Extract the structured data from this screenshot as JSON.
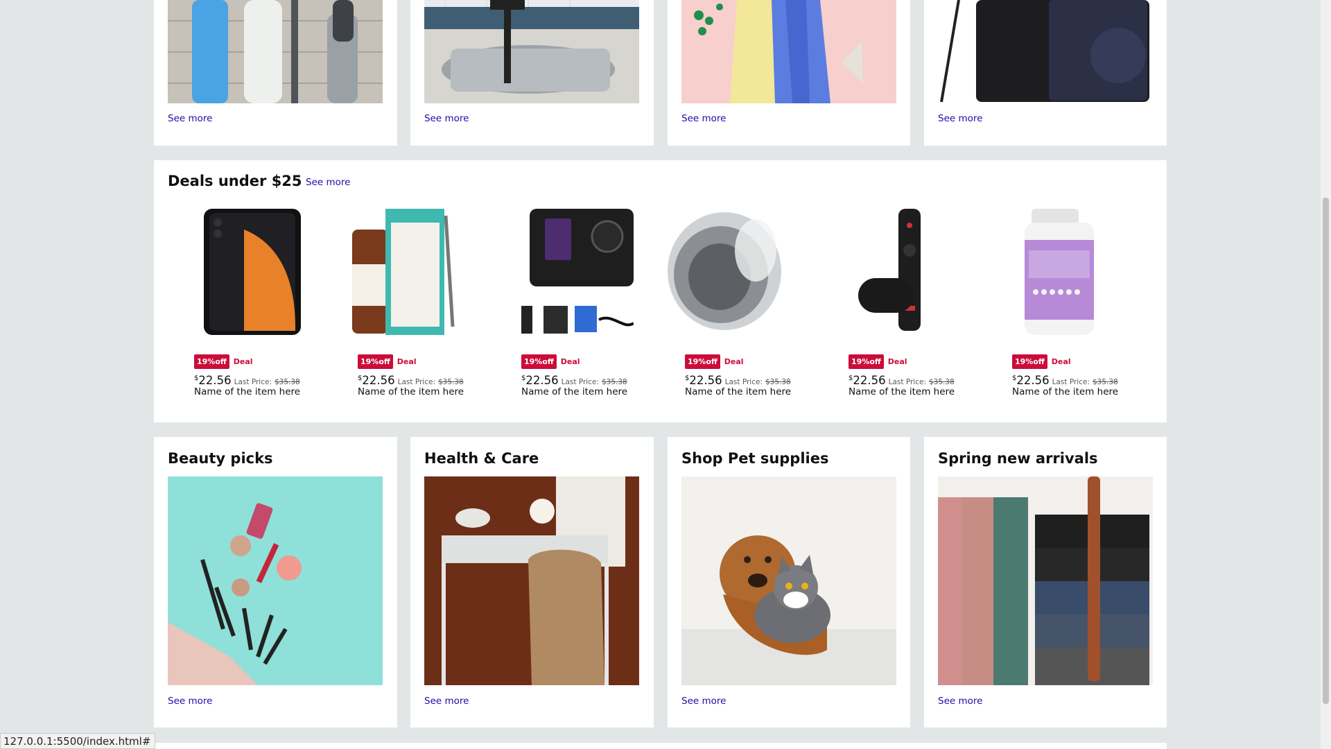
{
  "top_cards": [
    {
      "see_more": "See more"
    },
    {
      "see_more": "See more"
    },
    {
      "see_more": "See more"
    },
    {
      "see_more": "See more"
    }
  ],
  "deals": {
    "title": "Deals under $25",
    "see_more": "See more",
    "items": [
      {
        "off": "19%off",
        "deal": "Deal",
        "currency": "$",
        "price": "22.56",
        "last_label": "Last Price:",
        "last_price": "$35.38",
        "name": "Name of the item here"
      },
      {
        "off": "19%off",
        "deal": "Deal",
        "currency": "$",
        "price": "22.56",
        "last_label": "Last Price:",
        "last_price": "$35.38",
        "name": "Name of the item here"
      },
      {
        "off": "19%off",
        "deal": "Deal",
        "currency": "$",
        "price": "22.56",
        "last_label": "Last Price:",
        "last_price": "$35.38",
        "name": "Name of the item here"
      },
      {
        "off": "19%off",
        "deal": "Deal",
        "currency": "$",
        "price": "22.56",
        "last_label": "Last Price:",
        "last_price": "$35.38",
        "name": "Name of the item here"
      },
      {
        "off": "19%off",
        "deal": "Deal",
        "currency": "$",
        "price": "22.56",
        "last_label": "Last Price:",
        "last_price": "$35.38",
        "name": "Name of the item here"
      },
      {
        "off": "19%off",
        "deal": "Deal",
        "currency": "$",
        "price": "22.56",
        "last_label": "Last Price:",
        "last_price": "$35.38",
        "name": "Name of the item here"
      }
    ]
  },
  "bottom_cards": [
    {
      "title": "Beauty picks",
      "see_more": "See more"
    },
    {
      "title": "Health & Care",
      "see_more": "See more"
    },
    {
      "title": "Shop Pet supplies",
      "see_more": "See more"
    },
    {
      "title": "Spring new arrivals",
      "see_more": "See more"
    }
  ],
  "status_bar": {
    "url": "127.0.0.1:5500/index.html#"
  },
  "colors": {
    "page_bg": "#e3e6e6",
    "link": "#1a0dab",
    "deal_red": "#cc0c39"
  }
}
